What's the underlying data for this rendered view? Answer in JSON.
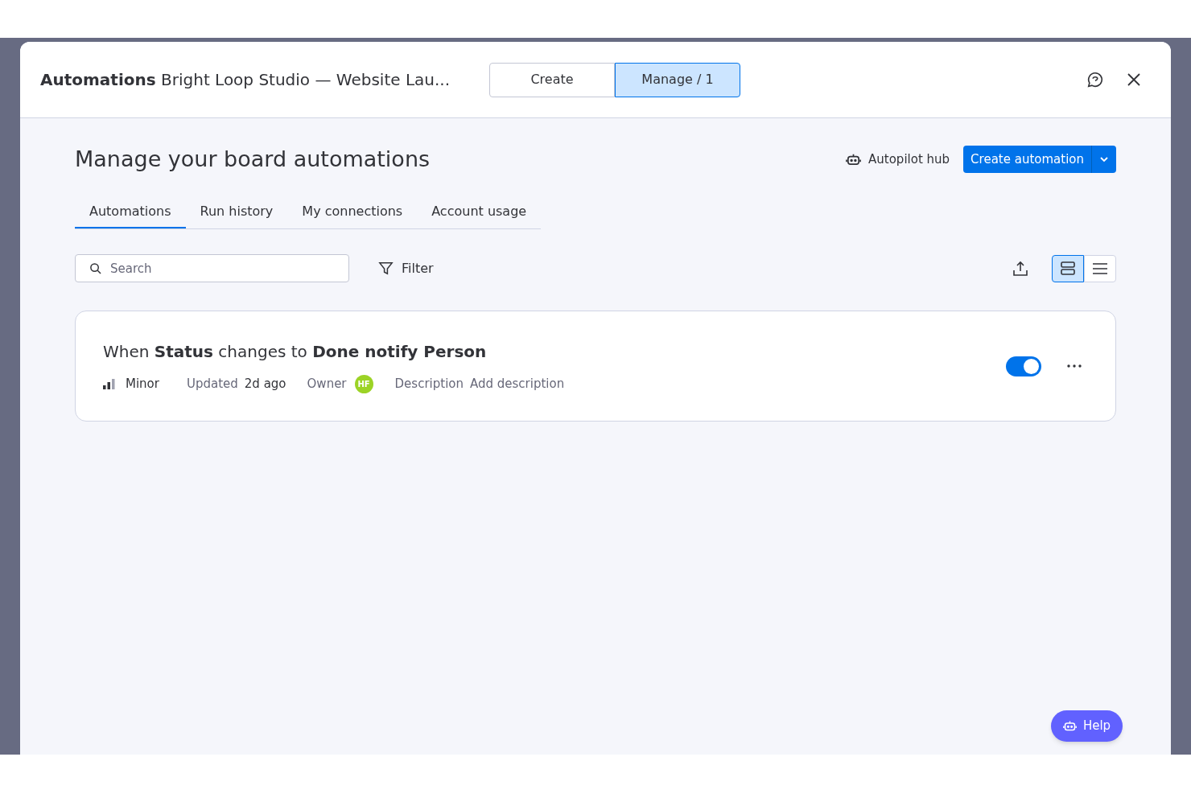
{
  "modal": {
    "title_bold": "Automations",
    "title": "Bright Loop Studio — Website Lau...",
    "mode_tabs": [
      {
        "label": "Create",
        "selected": false
      },
      {
        "label": "Manage / 1",
        "selected": true
      }
    ]
  },
  "heading": "Manage your board automations",
  "autopilot_hub": "Autopilot hub",
  "create_button": "Create automation",
  "tabs": [
    {
      "label": "Automations",
      "selected": true
    },
    {
      "label": "Run history",
      "selected": false
    },
    {
      "label": "My connections",
      "selected": false
    },
    {
      "label": "Account usage",
      "selected": false
    }
  ],
  "search": {
    "placeholder": "Search"
  },
  "filter": "Filter",
  "view_toggle": [
    {
      "kind": "cards",
      "selected": true
    },
    {
      "kind": "list",
      "selected": false
    }
  ],
  "automations": [
    {
      "title": "When **Status** changes to **Done notify Person**",
      "priority": "Minor",
      "updated_label": "Updated",
      "updated": "2d ago",
      "owner": {
        "label": "Owner",
        "initials": "HF",
        "color": "#9cd326"
      },
      "description_label": "Description",
      "description": "Add description",
      "on": true
    }
  ],
  "help": "Help"
}
